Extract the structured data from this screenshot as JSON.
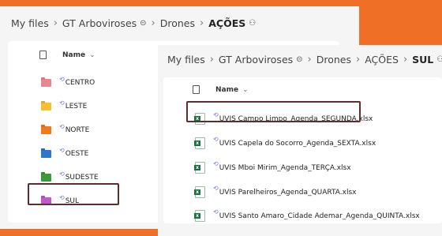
{
  "back_panel": {
    "breadcrumb": [
      "My files",
      "GT Arboviroses",
      "Drones",
      "AÇÕES"
    ],
    "column_header": "Name",
    "folders": [
      {
        "name": "CENTRO",
        "color": "#e8878f"
      },
      {
        "name": "LESTE",
        "color": "#f2c132"
      },
      {
        "name": "NORTE",
        "color": "#f07b1a"
      },
      {
        "name": "OESTE",
        "color": "#2b78c9"
      },
      {
        "name": "SUDESTE",
        "color": "#3b9a3b"
      },
      {
        "name": "SUL",
        "color": "#c259c8"
      }
    ]
  },
  "front_panel": {
    "breadcrumb": [
      "My files",
      "GT Arboviroses",
      "Drones",
      "AÇÕES",
      "SUL"
    ],
    "column_header": "Name",
    "files": [
      {
        "name": "UVIS Campo Limpo_Agenda_SEGUNDA.xlsx"
      },
      {
        "name": "UVIS Capela do Socorro_Agenda_SEXTA.xlsx"
      },
      {
        "name": "UVIS Mboi Mirim_Agenda_TERÇA.xlsx"
      },
      {
        "name": "UVIS Parelheiros_Agenda_QUARTA.xlsx"
      },
      {
        "name": "UVIS Santo Amaro_Cidade Ademar_Agenda_QUINTA.xlsx"
      }
    ]
  },
  "icons": {
    "link": "link-icon",
    "people": "people-icon",
    "sort": "chevron-down-icon",
    "sync": "sync-icon"
  },
  "colors": {
    "background": "#ee6f25",
    "highlight": "#5e2d2d",
    "excel": "#1d7044"
  }
}
